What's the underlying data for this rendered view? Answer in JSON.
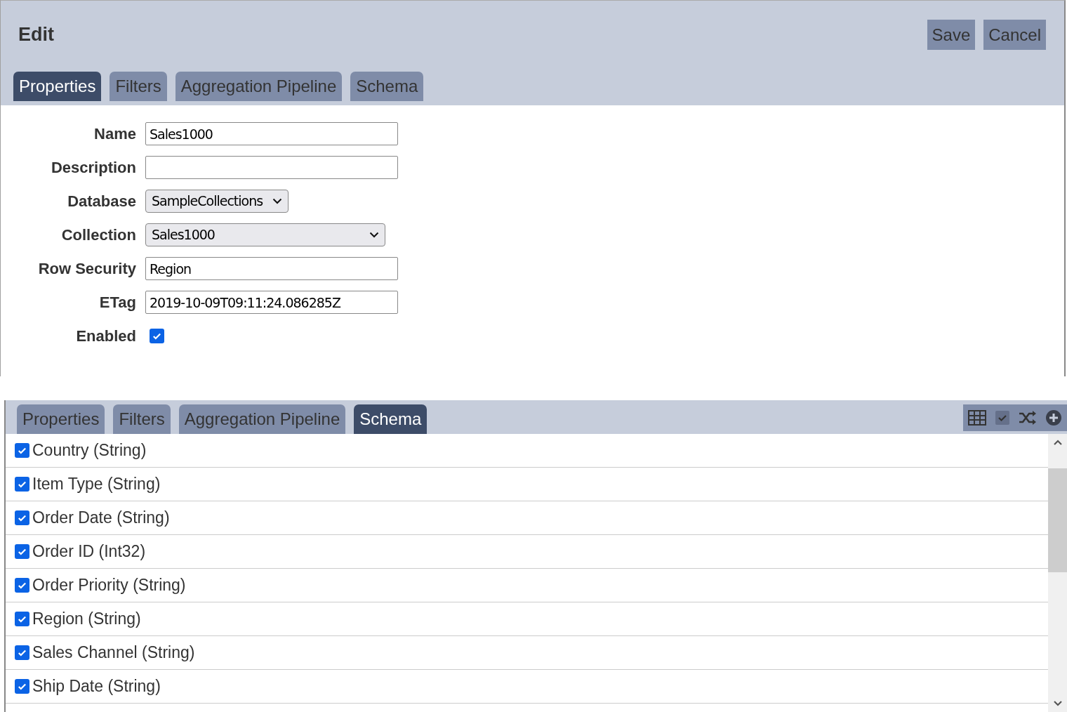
{
  "editor": {
    "title": "Edit",
    "buttons": [
      "Save",
      "Cancel"
    ],
    "tabs": [
      {
        "label": "Properties",
        "selected": true
      },
      {
        "label": "Filters",
        "selected": false
      },
      {
        "label": "Aggregation Pipeline",
        "selected": false
      },
      {
        "label": "Schema",
        "selected": false
      }
    ],
    "fields": [
      {
        "label": "Name",
        "kind": "text",
        "value": "Sales1000"
      },
      {
        "label": "Description",
        "kind": "text"
      },
      {
        "label": "Database",
        "kind": "select",
        "value": "SampleCollections",
        "wide": false
      },
      {
        "label": "Collection",
        "kind": "select",
        "value": "Sales1000",
        "wide": true
      },
      {
        "label": "Row Security",
        "kind": "text",
        "value": "Region"
      },
      {
        "label": "ETag",
        "kind": "text",
        "value": "2019-10-09T09:11:24.086285Z"
      },
      {
        "label": "Enabled",
        "kind": "checkbox",
        "checked": true
      }
    ]
  },
  "schema_panel": {
    "tabs": [
      {
        "label": "Properties",
        "selected": false
      },
      {
        "label": "Filters",
        "selected": false
      },
      {
        "label": "Aggregation Pipeline",
        "selected": false
      },
      {
        "label": "Schema",
        "selected": true
      }
    ],
    "fields": [
      {
        "label": "Country (String)",
        "checked": true
      },
      {
        "label": "Item Type (String)",
        "checked": true
      },
      {
        "label": "Order Date (String)",
        "checked": true
      },
      {
        "label": "Order ID (Int32)",
        "checked": true
      },
      {
        "label": "Order Priority (String)",
        "checked": true
      },
      {
        "label": "Region (String)",
        "checked": true
      },
      {
        "label": "Sales Channel (String)",
        "checked": true
      },
      {
        "label": "Ship Date (String)",
        "checked": true
      }
    ]
  }
}
